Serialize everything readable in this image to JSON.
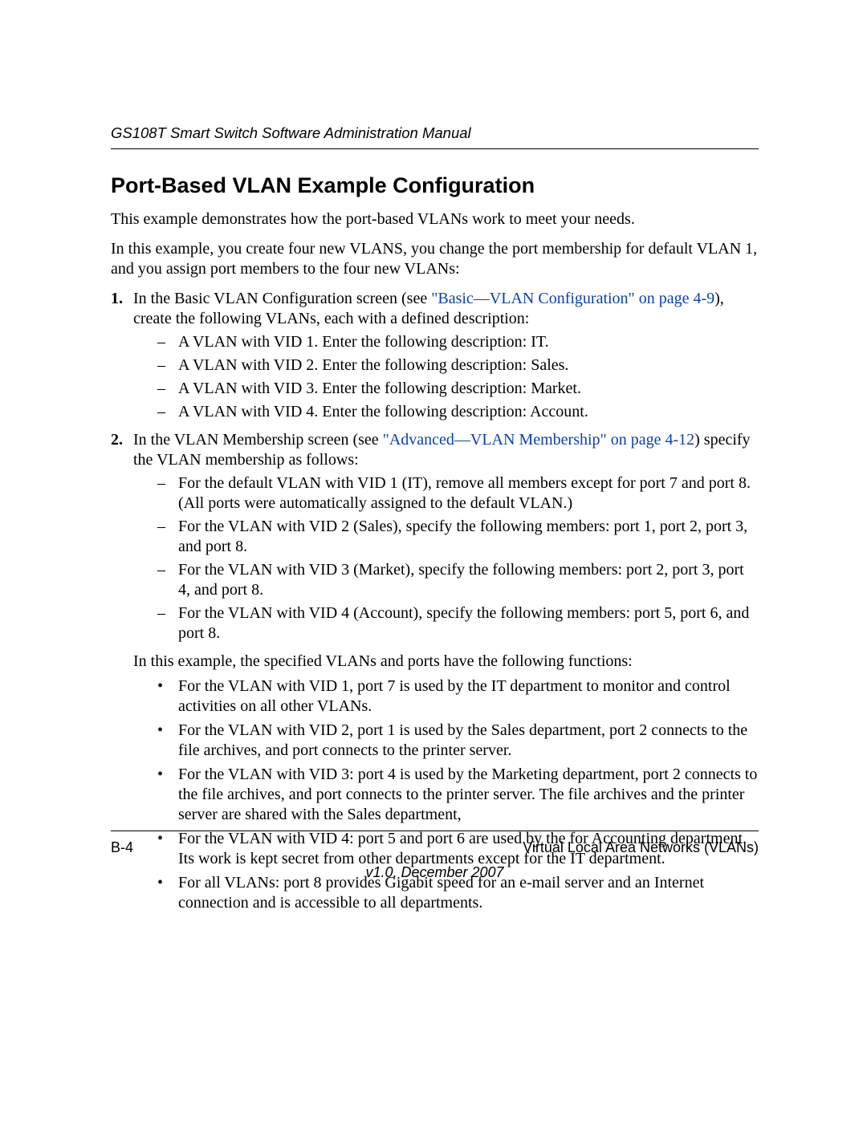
{
  "header": {
    "running": "GS108T Smart Switch Software Administration Manual"
  },
  "title": "Port-Based VLAN Example Configuration",
  "intro1": "This example demonstrates how the port-based VLANs work to meet your needs.",
  "intro2": "In this example, you create four new VLANS, you change the port membership for default VLAN 1, and you assign port members to the four new VLANs:",
  "step1": {
    "num": "1.",
    "pre": "In the Basic VLAN Configuration screen (see ",
    "link": "\"Basic—VLAN Configuration\" on page 4-9",
    "post": "), create the following VLANs, each with a defined description:",
    "items": [
      "A VLAN with VID 1. Enter the following description: IT.",
      "A VLAN with VID 2. Enter the following description: Sales.",
      "A VLAN with VID 3. Enter the following description: Market.",
      "A VLAN with VID 4. Enter the following description: Account."
    ]
  },
  "step2": {
    "num": "2.",
    "pre": "In the VLAN Membership screen (see ",
    "link": "\"Advanced—VLAN Membership\" on page 4-12",
    "post": ") specify the VLAN membership as follows:",
    "items": [
      "For the default VLAN with VID 1 (IT), remove all members except for port 7 and port 8. (All ports were automatically assigned to the default VLAN.)",
      "For the VLAN with VID 2 (Sales), specify the following members: port 1, port 2, port 3, and port 8.",
      "For the VLAN with VID 3 (Market), specify the following members: port 2, port 3, port 4, and port 8.",
      "For the VLAN with VID 4 (Account), specify the following members: port 5, port 6, and port 8."
    ],
    "mid": "In this example, the specified VLANs and ports have the following functions:",
    "bullets": [
      "For the VLAN with VID 1, port 7 is used by the IT department to monitor and control activities on all other VLANs.",
      "For the VLAN with VID 2, port 1 is used by the Sales department, port 2 connects to the file archives, and port connects to the printer server.",
      "For the VLAN with VID 3: port 4 is used by the Marketing department, port 2 connects to the file archives, and port connects to the printer server. The file archives and the printer server are shared with the Sales department,",
      "For the VLAN with VID 4: port 5 and port 6 are used by the for Accounting department. Its work is kept secret from other departments except for the IT department.",
      "For all VLANs: port 8 provides Gigabit speed for an e-mail server and an Internet connection and is accessible to all departments."
    ]
  },
  "footer": {
    "left": "B-4",
    "right": "Virtual Local Area Networks (VLANs)",
    "version": "v1.0, December 2007"
  }
}
